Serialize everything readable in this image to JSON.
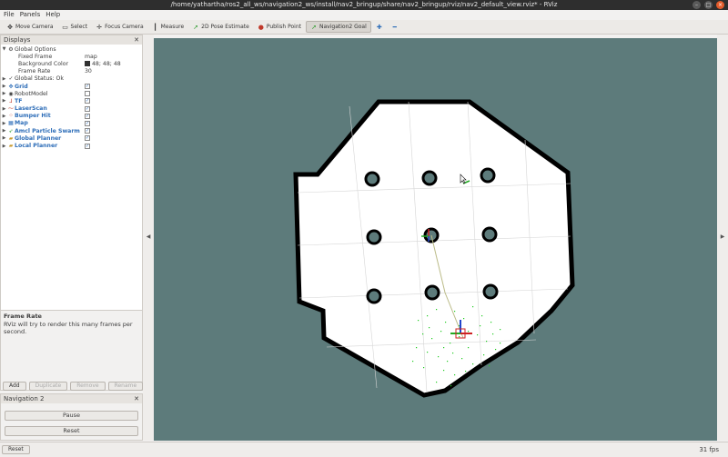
{
  "window": {
    "title": "/home/yathartha/ros2_all_ws/navigation2_ws/install/nav2_bringup/share/nav2_bringup/rviz/nav2_default_view.rviz* - RViz"
  },
  "menu": [
    "File",
    "Panels",
    "Help"
  ],
  "toolbar": [
    {
      "label": "Move Camera",
      "icon": "move-icon"
    },
    {
      "label": "Select",
      "icon": "select-icon"
    },
    {
      "label": "Focus Camera",
      "icon": "focus-icon"
    },
    {
      "label": "Measure",
      "icon": "measure-icon"
    },
    {
      "label": "2D Pose Estimate",
      "icon": "pose-arrow-icon"
    },
    {
      "label": "Publish Point",
      "icon": "pin-icon"
    },
    {
      "label": "Navigation2 Goal",
      "icon": "goal-arrow-icon",
      "active": true
    }
  ],
  "displays_panel": {
    "title": "Displays",
    "global_options_label": "Global Options",
    "fixed_frame_label": "Fixed Frame",
    "fixed_frame_value": "map",
    "bg_color_label": "Background Color",
    "bg_color_value": "48; 48; 48",
    "bg_color_hex": "#303030",
    "frame_rate_label": "Frame Rate",
    "frame_rate_value": "30",
    "global_status": "Global Status: Ok",
    "robot_model_label": "RobotModel",
    "items": [
      {
        "label": "Grid",
        "checked": true
      },
      {
        "label": "TF",
        "checked": true
      },
      {
        "label": "LaserScan",
        "checked": true
      },
      {
        "label": "Bumper Hit",
        "checked": true
      },
      {
        "label": "Map",
        "checked": true
      },
      {
        "label": "Amcl Particle Swarm",
        "checked": true
      },
      {
        "label": "Global Planner",
        "checked": true
      },
      {
        "label": "Local Planner",
        "checked": true
      }
    ]
  },
  "help": {
    "title": "Frame Rate",
    "description": "RViz will try to render this many frames per second."
  },
  "panel_buttons": {
    "add": "Add",
    "duplicate": "Duplicate",
    "remove": "Remove",
    "rename": "Rename"
  },
  "nav2_panel": {
    "title": "Navigation 2",
    "pause": "Pause",
    "reset": "Reset"
  },
  "status": {
    "reset": "Reset",
    "fps": "31 fps"
  },
  "colors": {
    "background": "#5d7b7b",
    "map_free": "#ffffff",
    "map_wall": "#000000",
    "particles": "#22cc22"
  }
}
